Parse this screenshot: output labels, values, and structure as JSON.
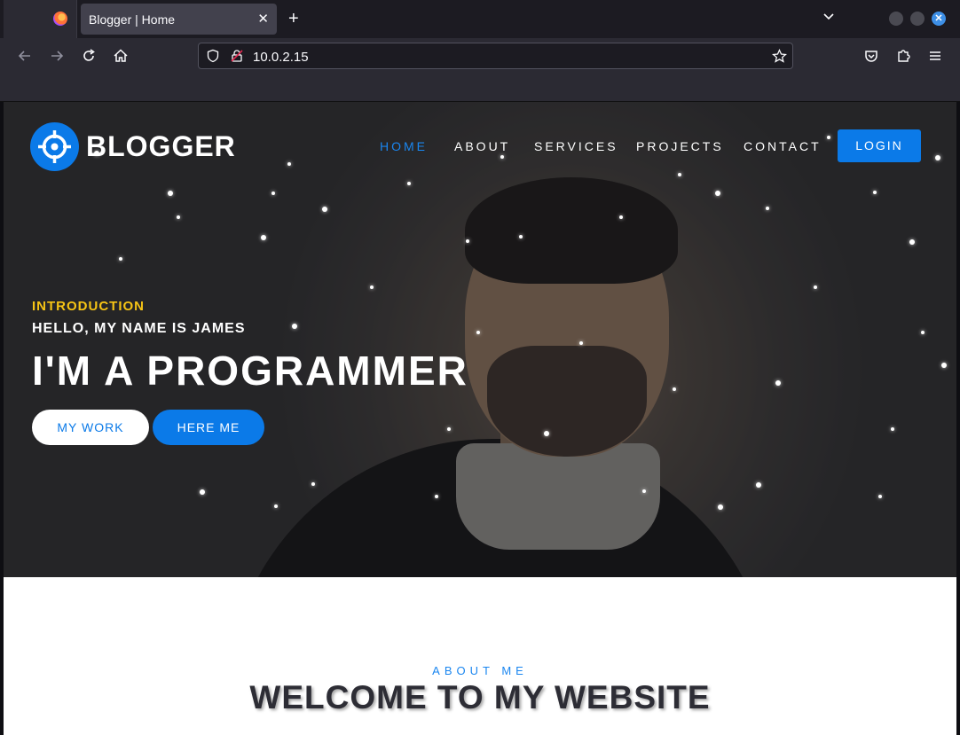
{
  "browser": {
    "tab_title": "Blogger | Home",
    "tab_close": "✕",
    "new_tab": "+",
    "url": "10.0.2.15"
  },
  "site": {
    "brand": "BLOGGER",
    "menu": [
      {
        "label": "HOME",
        "active": true
      },
      {
        "label": "ABOUT",
        "active": false
      },
      {
        "label": "SERVICES",
        "active": false
      },
      {
        "label": "PROJECTS",
        "active": false
      },
      {
        "label": "CONTACT",
        "active": false
      }
    ],
    "login_label": "LOGIN"
  },
  "hero": {
    "intro": "INTRODUCTION",
    "hello": "HELLO, MY NAME IS JAMES",
    "headline": "I'M A PROGRAMMER",
    "btn_work": "MY WORK",
    "btn_here": "HERE ME"
  },
  "about": {
    "kicker": "ABOUT ME",
    "title": "WELCOME TO MY WEBSITE"
  },
  "colors": {
    "accent": "#0b7ae8",
    "intro_yellow": "#f6c415",
    "heading_dark": "#2d2d35"
  }
}
